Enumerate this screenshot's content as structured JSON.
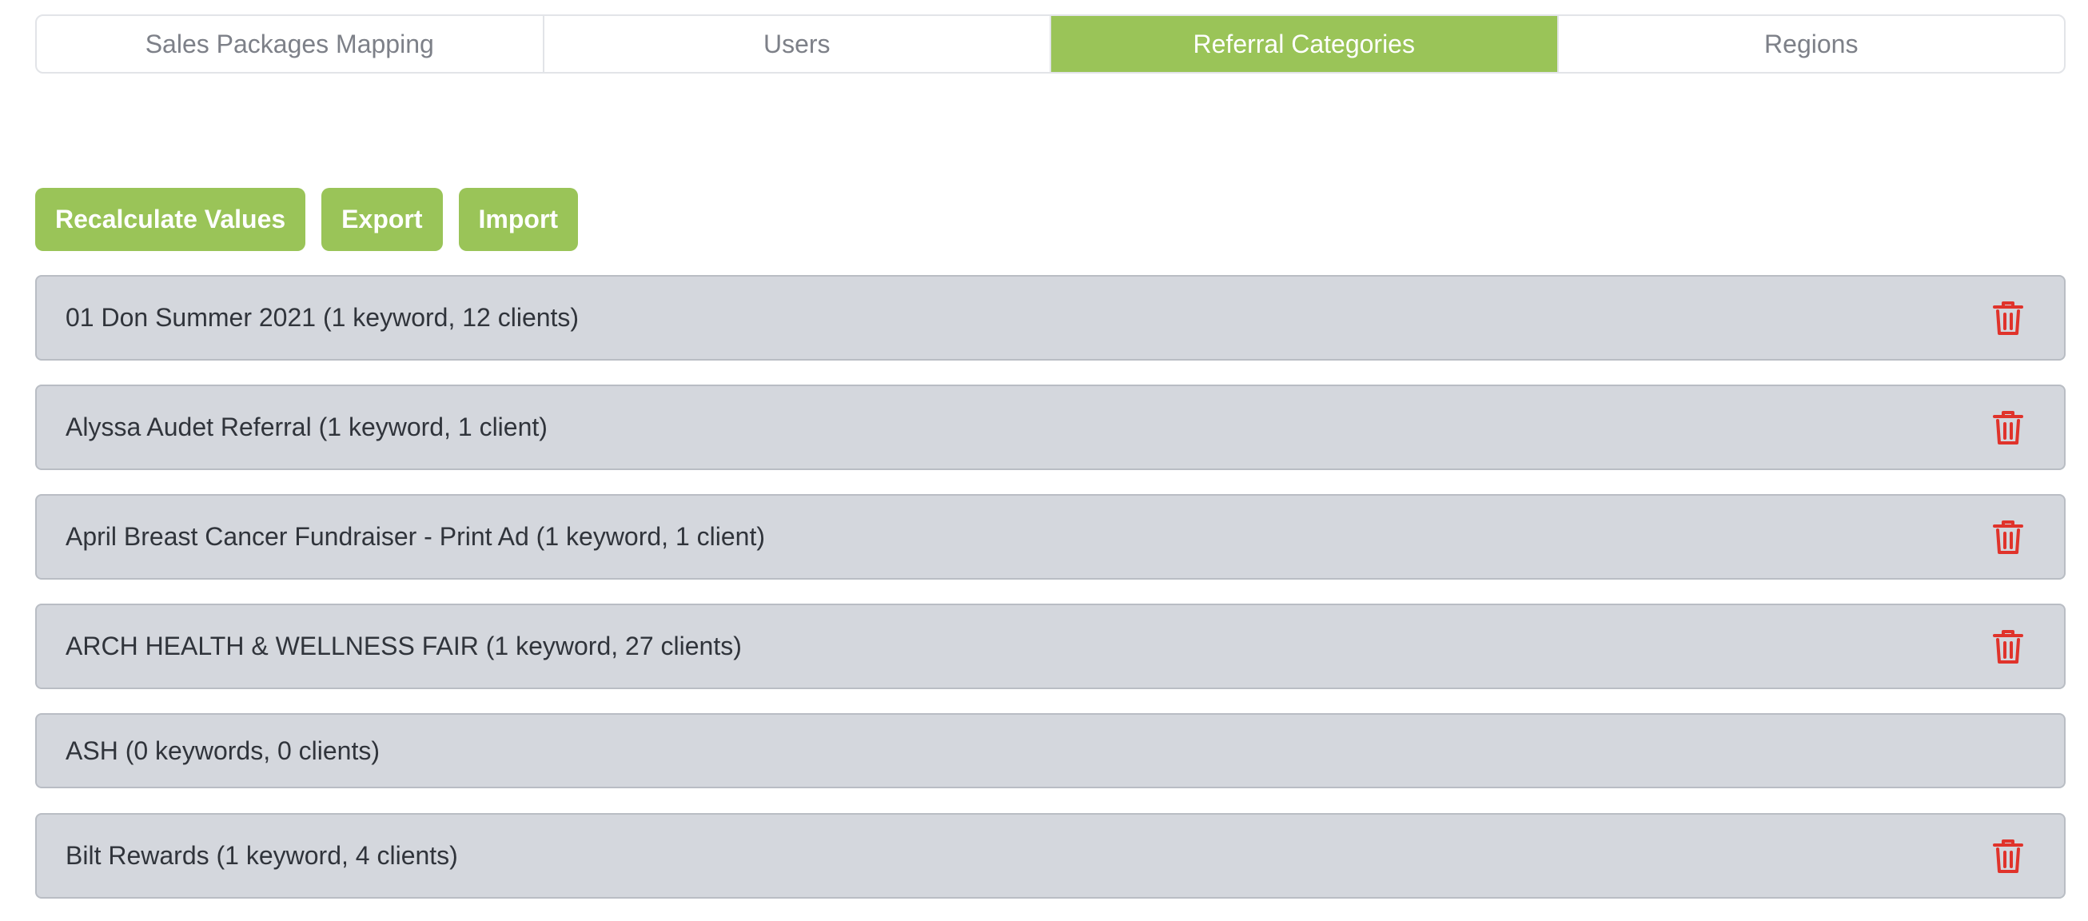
{
  "tabs": [
    {
      "label": "Sales Packages Mapping",
      "active": false
    },
    {
      "label": "Users",
      "active": false
    },
    {
      "label": "Referral Categories",
      "active": true
    },
    {
      "label": "Regions",
      "active": false
    }
  ],
  "actions": {
    "recalculate_label": "Recalculate Values",
    "export_label": "Export",
    "import_label": "Import"
  },
  "categories": [
    {
      "label": "01 Don Summer 2021 (1 keyword, 12 clients)",
      "deletable": true
    },
    {
      "label": "Alyssa Audet Referral (1 keyword, 1 client)",
      "deletable": true
    },
    {
      "label": "April Breast Cancer Fundraiser - Print Ad (1 keyword, 1 client)",
      "deletable": true
    },
    {
      "label": "ARCH HEALTH & WELLNESS FAIR (1 keyword, 27 clients)",
      "deletable": true
    },
    {
      "label": "ASH (0 keywords, 0 clients)",
      "deletable": false
    },
    {
      "label": "Bilt Rewards (1 keyword, 4 clients)",
      "deletable": true
    }
  ],
  "colors": {
    "accent": "#9ac458",
    "row_bg": "#d4d7dd",
    "delete": "#e0332b"
  },
  "icons": {
    "delete": "trash-icon"
  }
}
